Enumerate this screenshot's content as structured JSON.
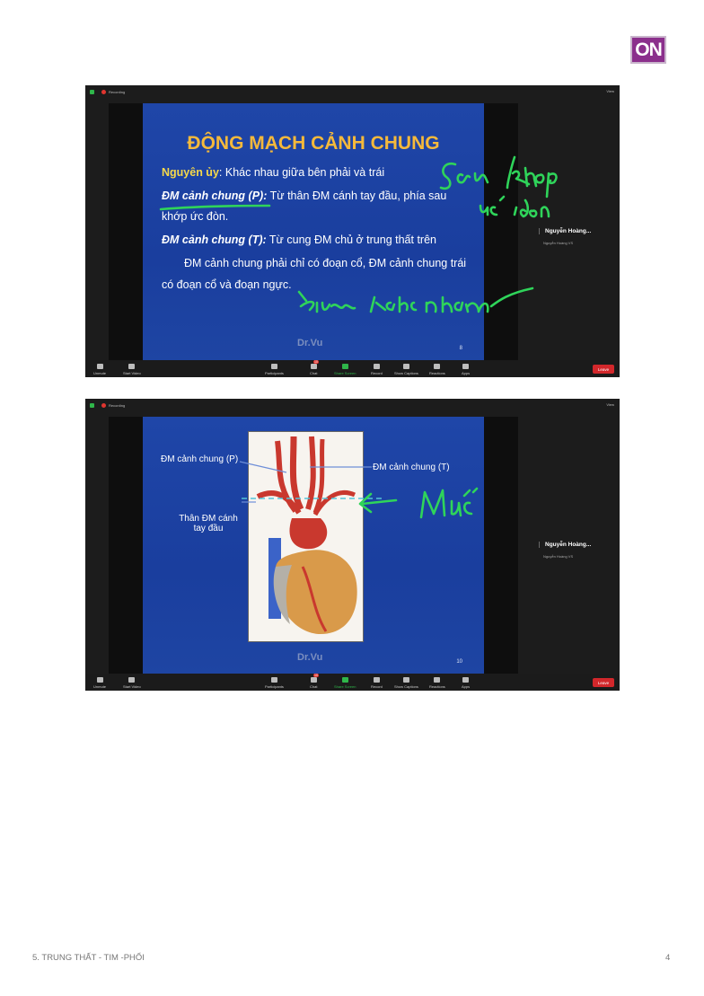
{
  "badge": "ON",
  "footer": {
    "section": "5. TRUNG THẤT - TIM -PHỔI",
    "page": "4"
  },
  "zoom": {
    "recording_label": "Recording",
    "view_label": "View",
    "participant_name": "Nguyễn Hoàng...",
    "participant_sub": "Nguyễn Hoàng VS",
    "toolbar": {
      "unmute": "Unmute",
      "start_video": "Start Video",
      "participants": "Participants",
      "chat": "Chat",
      "share_screen": "Share Screen",
      "record": "Record",
      "show_captions": "Show Captions",
      "reactions": "Reactions",
      "apps": "Apps",
      "leave": "Leave",
      "participants_count_1": "347",
      "participants_count_2": "346",
      "chat_badge": "10"
    }
  },
  "slide1": {
    "title": "ĐỘNG MẠCH CẢNH CHUNG",
    "origin_label": "Nguyên ủy",
    "origin_text": ": Khác nhau giữa bên phải và trái",
    "right_label": "ĐM cảnh chung (P):",
    "right_text_1": " Từ thân ĐM cánh tay đầu, phía sau",
    "right_text_2": "khớp ức đòn.",
    "left_label": "ĐM cảnh chung (T):",
    "left_text": " Từ cung ĐM chủ ở trung thất trên",
    "note_1": "ĐM cảnh chung phải chỉ có đoạn cổ, ĐM cảnh chung trái",
    "note_2": "có đoạn cổ và đoạn ngực.",
    "watermark": "Dr.Vu",
    "page": "8"
  },
  "slide2": {
    "label_right_common": "ĐM cảnh chung (P)",
    "label_left_common": "ĐM cảnh chung (T)",
    "label_trunk_1": "Thân ĐM cánh",
    "label_trunk_2": "tay đầu",
    "watermark": "Dr.Vu",
    "page": "10"
  },
  "ink_color": "#2fd45a"
}
